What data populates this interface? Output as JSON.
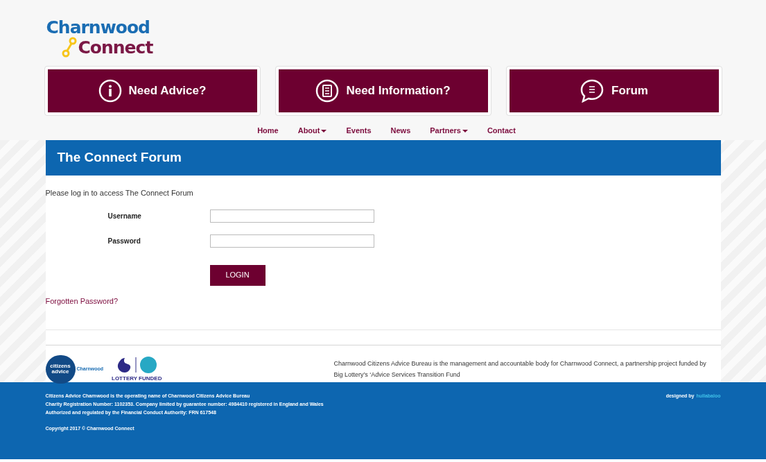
{
  "logo": {
    "line_1": "Charnwood",
    "line_2": "Connect"
  },
  "feature_buttons": [
    {
      "kind": "info",
      "label": "Need Advice?"
    },
    {
      "kind": "document",
      "label": "Need Information?"
    },
    {
      "kind": "chat",
      "label": "Forum"
    }
  ],
  "nav": [
    {
      "label": "Home",
      "dropdown": false
    },
    {
      "label": "About",
      "dropdown": true
    },
    {
      "label": "Events",
      "dropdown": false
    },
    {
      "label": "News",
      "dropdown": false
    },
    {
      "label": "Partners",
      "dropdown": true
    },
    {
      "label": "Contact",
      "dropdown": false
    }
  ],
  "page_title": "The Connect Forum",
  "intro": "Please log in to access The Connect Forum",
  "form": {
    "fields": [
      {
        "label": "Username"
      },
      {
        "label": "Password"
      }
    ],
    "submit": "LOGIN",
    "forgot_link": "Forgotten Password?"
  },
  "partners": {
    "citizens_logo": "citizens advice",
    "citizens_place": "Charnwood",
    "lottery_caption": "LOTTERY FUNDED",
    "statement": "Charnwood Citizens Advice Bureau is the management and accountable body for Charnwood Connect, a partnership project funded by Big Lottery’s ‘Advice Services Transition Fund"
  },
  "footer": {
    "lines": [
      "Citizens Advice Charnwood is the operating name of Charnwood Citizens Advice Bureau",
      "Charity Registration Number: 1102353. Company limited by guarantee number: 4984410 registered in England and Wales",
      "Authorized and regulated by the Financial Conduct Authority: FRN 617548"
    ],
    "copyright": "Copyright 2017 © Charnwood Connect",
    "credit_prefix": "designed by",
    "credit_name": "hullabaloo"
  }
}
